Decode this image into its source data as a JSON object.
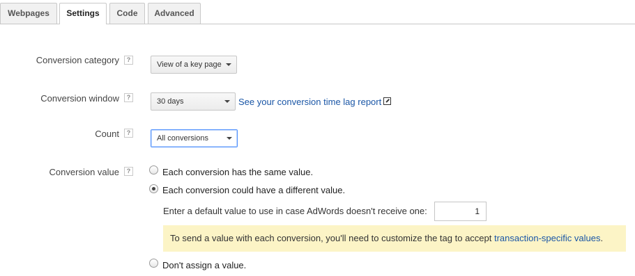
{
  "tabs": [
    "Webpages",
    "Settings",
    "Code",
    "Advanced"
  ],
  "active_tab": "Settings",
  "help_glyph": "?",
  "conversion_category": {
    "label": "Conversion category",
    "value": "View of a key page"
  },
  "conversion_window": {
    "label": "Conversion window",
    "value": "30 days",
    "link": "See your conversion time lag report"
  },
  "count": {
    "label": "Count",
    "value": "All conversions"
  },
  "conversion_value": {
    "label": "Conversion value",
    "options": [
      {
        "label": "Each conversion has the same value.",
        "checked": false
      },
      {
        "label": "Each conversion could have a different value.",
        "checked": true
      },
      {
        "label": "Don't assign a value.",
        "checked": false
      }
    ],
    "default_prompt": "Enter a default value to use in case AdWords doesn't receive one:",
    "default_value": "1",
    "note_text": "To send a value with each conversion, you'll need to customize the tag to accept ",
    "note_link": "transaction-specific values",
    "note_end": "."
  },
  "colors": {
    "link": "#1a56a6",
    "note_bg": "#fcf4c6",
    "focus_border": "#4d90fe"
  }
}
